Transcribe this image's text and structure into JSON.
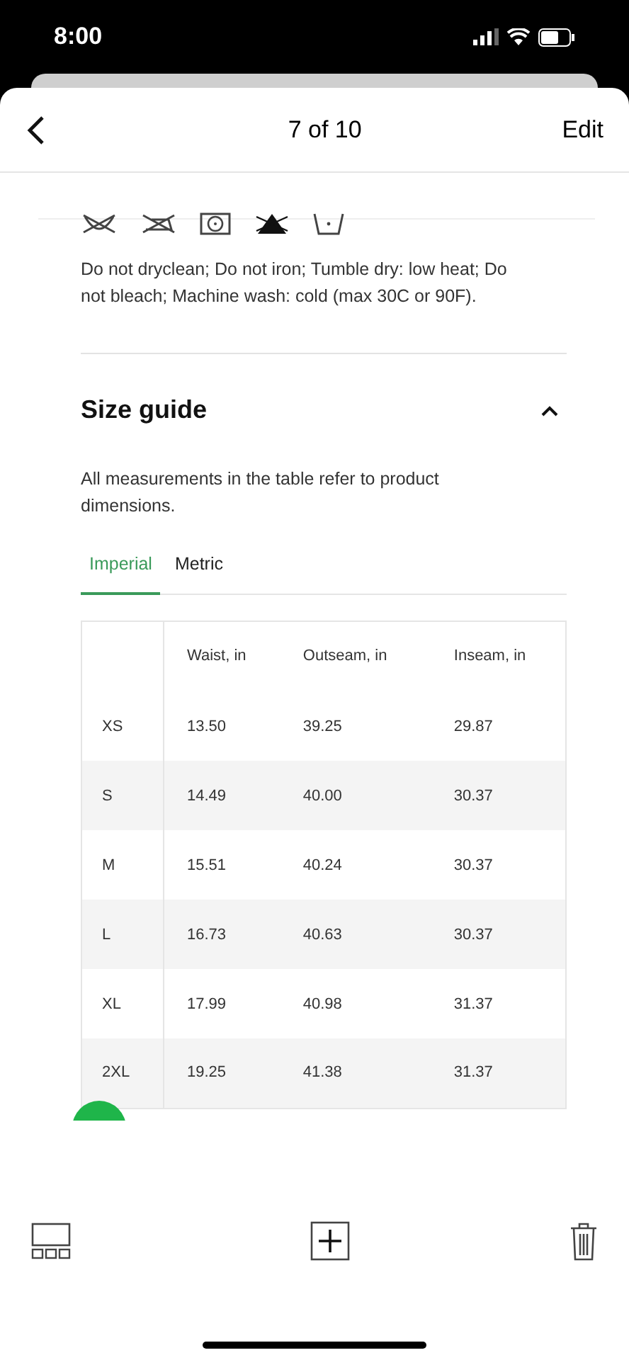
{
  "status_bar": {
    "time": "8:00"
  },
  "header": {
    "title": "7 of 10",
    "edit": "Edit"
  },
  "care": {
    "text": "Do not dryclean; Do not iron; Tumble dry: low heat; Do not bleach; Machine wash: cold (max 30C or 90F)."
  },
  "size_guide": {
    "title": "Size guide",
    "expanded": true,
    "description": "All measurements in the table refer to product dimensions.",
    "tabs": [
      {
        "label": "Imperial",
        "selected": true
      },
      {
        "label": "Metric",
        "selected": false
      }
    ],
    "table": {
      "columns": [
        "Waist, in",
        "Outseam, in",
        "Inseam, in"
      ],
      "rows": [
        {
          "size": "XS",
          "values": [
            "13.50",
            "39.25",
            "29.87"
          ]
        },
        {
          "size": "S",
          "values": [
            "14.49",
            "40.00",
            "30.37"
          ]
        },
        {
          "size": "M",
          "values": [
            "15.51",
            "40.24",
            "30.37"
          ]
        },
        {
          "size": "L",
          "values": [
            "16.73",
            "40.63",
            "30.37"
          ]
        },
        {
          "size": "XL",
          "values": [
            "17.99",
            "40.98",
            "31.37"
          ]
        },
        {
          "size": "2XL",
          "values": [
            "19.25",
            "41.38",
            "31.37"
          ]
        }
      ]
    }
  }
}
